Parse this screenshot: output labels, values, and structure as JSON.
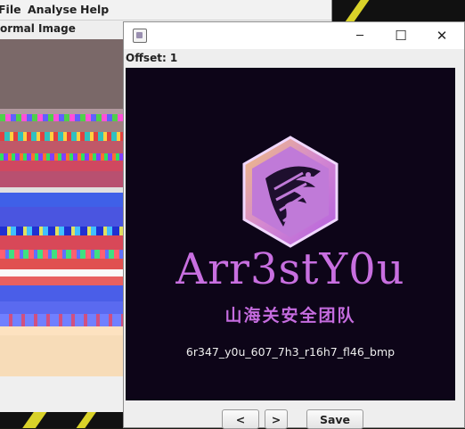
{
  "main_window": {
    "menu": [
      "File",
      "Analyse",
      "Help"
    ],
    "view_label": "ormal Image"
  },
  "frame_window": {
    "offset_label": "Offset: 1",
    "controls": {
      "minimize": "─",
      "maximize": "☐",
      "close": "✕"
    },
    "image": {
      "brand": "Arr3stY0u",
      "team": "山海关安全团队",
      "flag": "6r347_y0u_607_7h3_r16h7_fl46_bmp"
    },
    "buttons": {
      "prev": "<",
      "next": ">",
      "save": "Save"
    }
  },
  "colors": {
    "brand_purple": "#c86fe0",
    "canvas_bg": "#0d0518"
  }
}
